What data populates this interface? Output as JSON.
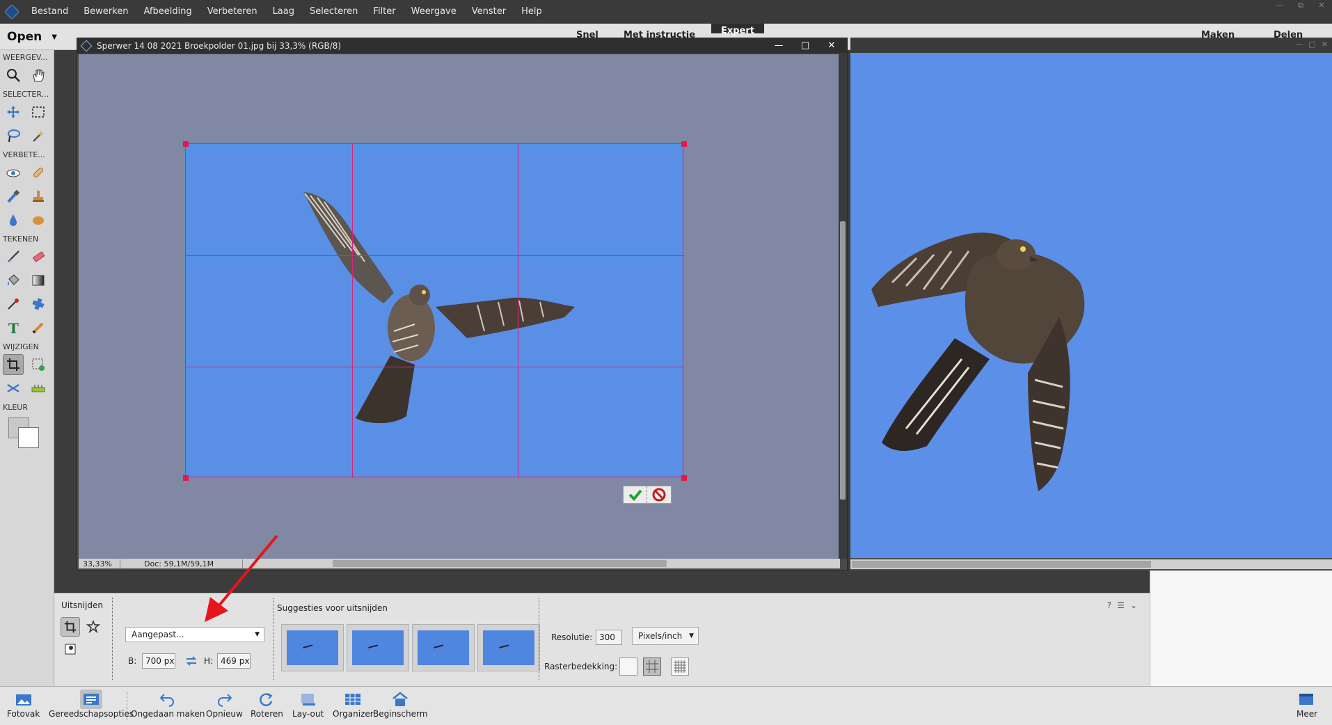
{
  "menubar": {
    "items": [
      "Bestand",
      "Bewerken",
      "Afbeelding",
      "Verbeteren",
      "Laag",
      "Selecteren",
      "Filter",
      "Weergave",
      "Venster",
      "Help"
    ]
  },
  "header": {
    "open_label": "Open",
    "tabs": [
      "Snel",
      "Met instructie",
      "Expert"
    ],
    "right_tabs": [
      "Maken",
      "Delen"
    ]
  },
  "toolbox": {
    "sections": [
      "WEERGEV...",
      "SELECTER...",
      "VERBETE...",
      "TEKENEN",
      "WIJZIGEN",
      "KLEUR"
    ]
  },
  "document": {
    "title": "Sperwer 14 08 2021 Broekpolder 01.jpg bij 33,3% (RGB/8)",
    "zoom": "33,33%",
    "doc_info": "Doc: 59,1M/59,1M"
  },
  "options": {
    "title": "Uitsnijden",
    "preset": "Aangepast...",
    "width_label": "B:",
    "width_value": "700 px",
    "height_label": "H:",
    "height_value": "469 px",
    "suggestions_label": "Suggesties voor uitsnijden",
    "resolution_label": "Resolutie:",
    "resolution_value": "300",
    "resolution_units": "Pixels/inch",
    "overlay_label": "Rasterbedekking:"
  },
  "taskbar": {
    "items": [
      "Fotovak",
      "Gereedschapsopties",
      "Ongedaan maken",
      "Opnieuw",
      "Roteren",
      "Lay-out",
      "Organizer",
      "Beginscherm"
    ],
    "more": "Meer"
  },
  "colors": {
    "sky": "#5a8fe6",
    "crop_grid": "#d8257c",
    "canvas_bg": "#8088a4",
    "annotation_arrow": "#e8141c"
  }
}
